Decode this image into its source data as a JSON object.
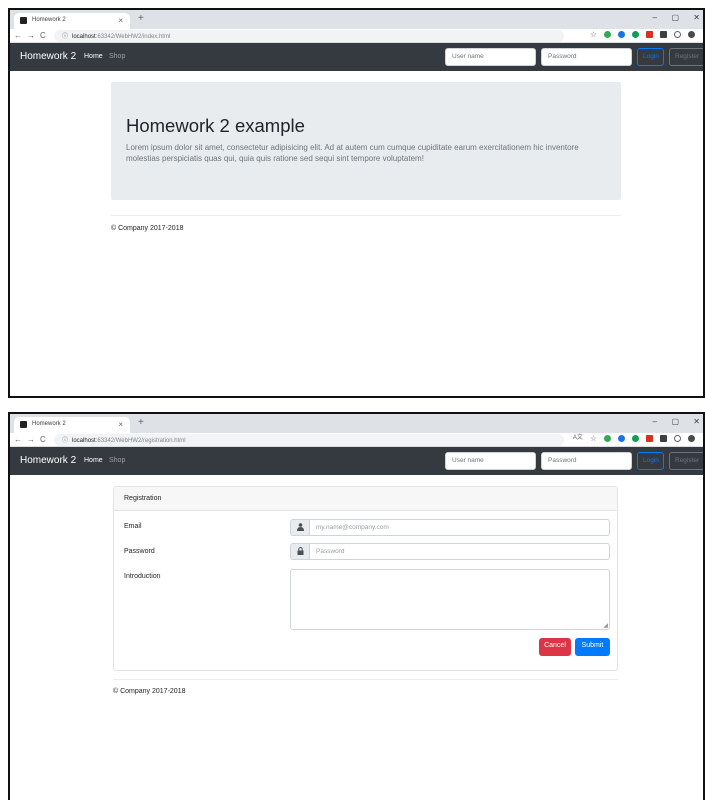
{
  "browser": {
    "tab_title": "Homework 2",
    "tab_close": "×",
    "new_tab": "+",
    "min": "–",
    "max": "▢",
    "close": "✕",
    "back": "←",
    "forward": "→",
    "reload": "C",
    "info_icon": "ⓘ",
    "url_host": "localhost",
    "url_path_home": ":63342/WebHW2/index.html",
    "url_path_reg": ":63342/WebHW2/registration.html",
    "star": "☆",
    "translate": "A文",
    "ext_colors": [
      "#34a853",
      "#1a73e8",
      "#0f9d58",
      "#d93025",
      "#3c4043",
      "#5f6368",
      "#4a4a4a"
    ]
  },
  "navbar": {
    "brand": "Homework 2",
    "home": "Home",
    "shop": "Shop",
    "username_placeholder": "User name",
    "password_placeholder": "Password",
    "login": "Login",
    "register": "Register"
  },
  "home_page": {
    "title": "Homework 2 example",
    "lead": "Lorem ipsum dolor sit amet, consectetur adipisicing elit. Ad at autem cum cumque cupiditate earum exercitationem hic inventore molestias perspiciatis quas qui, quia quis ratione sed sequi sint tempore voluptatem!",
    "footer": "© Company 2017-2018"
  },
  "registration_page": {
    "header": "Registration",
    "email_label": "Email",
    "email_placeholder": "my.name@company.com",
    "password_label": "Password",
    "password_placeholder": "Password",
    "intro_label": "Introduction",
    "user_icon": "👤",
    "lock_icon": "🔒",
    "cancel": "Cancel",
    "submit": "Submit",
    "footer": "© Company 2017-2018"
  }
}
